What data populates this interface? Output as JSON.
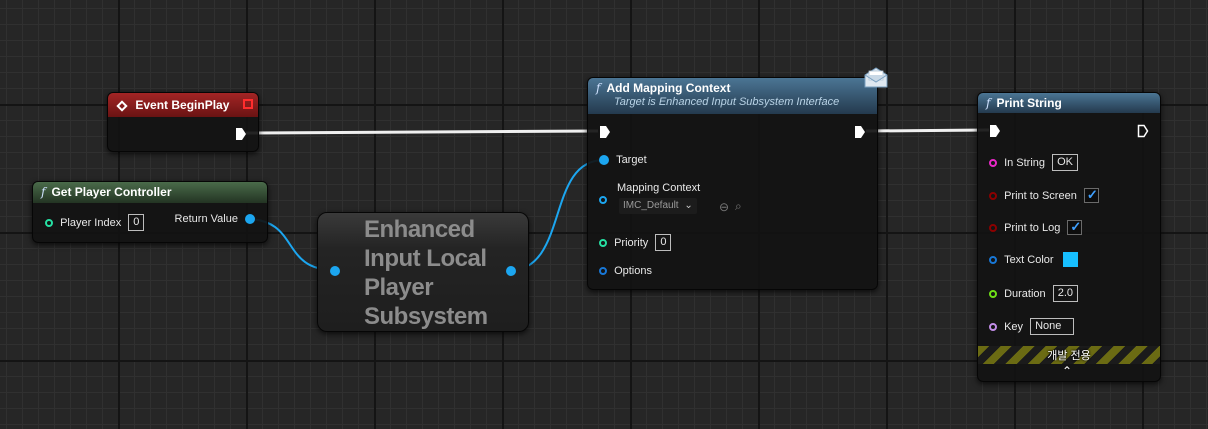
{
  "colors": {
    "exec": "#ffffff",
    "object": "#1ca6f0",
    "int": "#26e0a3",
    "string": "#ea28c9",
    "bool": "#8c0000",
    "struct": "#1877d6",
    "float": "#6fe017",
    "name": "#c28de8",
    "event_header": "#8c1a1a",
    "pure_header": "#3b5d3b",
    "call_header": "#2f4b64",
    "text_color_swatch": "#17bfff",
    "dev_stripe": "#6b6b13"
  },
  "nodes": {
    "event_beginplay": {
      "title": "Event BeginPlay",
      "icon": "event-diamond-icon"
    },
    "get_player_controller": {
      "title": "Get Player Controller",
      "icon": "function-icon",
      "player_index_label": "Player Index",
      "player_index_value": "0",
      "return_value_label": "Return Value"
    },
    "subsystem": {
      "title": "Enhanced Input Local Player Subsystem"
    },
    "add_mapping_context": {
      "title": "Add Mapping Context",
      "subtitle": "Target is Enhanced Input Subsystem Interface",
      "icon": "function-icon",
      "message_icon": "envelope-icon",
      "target_label": "Target",
      "mapping_context_label": "Mapping Context",
      "mapping_context_value": "IMC_Default",
      "priority_label": "Priority",
      "priority_value": "0",
      "options_label": "Options"
    },
    "print_string": {
      "title": "Print String",
      "icon": "function-icon",
      "in_string_label": "In String",
      "in_string_value": "OK",
      "print_to_screen_label": "Print to Screen",
      "print_to_screen_checked": true,
      "print_to_log_label": "Print to Log",
      "print_to_log_checked": true,
      "text_color_label": "Text Color",
      "duration_label": "Duration",
      "duration_value": "2.0",
      "key_label": "Key",
      "key_value": "None",
      "dev_only_label": "개발 전용",
      "expand_icon": "chevron-up-icon"
    }
  }
}
